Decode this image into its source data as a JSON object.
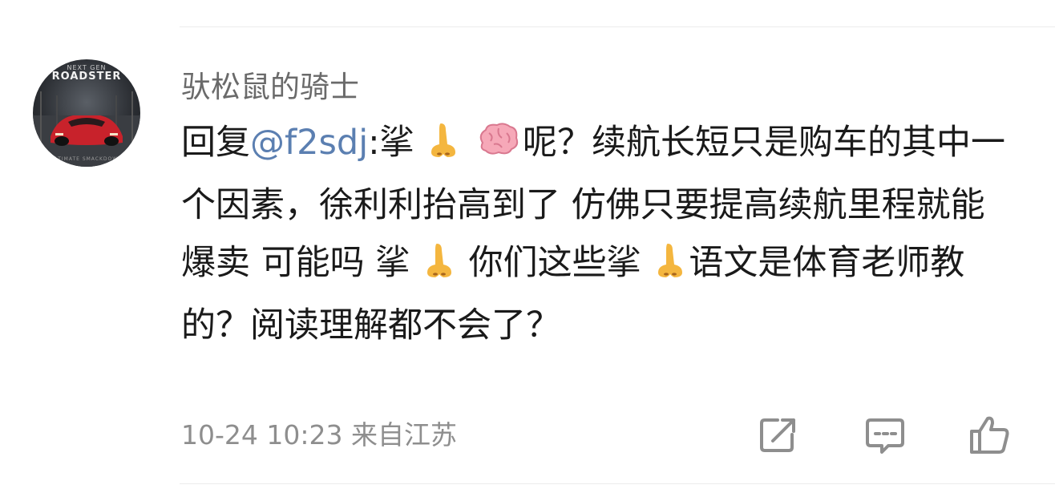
{
  "post": {
    "username": "驮松鼠的骑士",
    "avatar": {
      "brand_top": "NEXT GEN",
      "brand": "ROADSTER",
      "brand_bottom": "ULTIMATE SMACKDOWN",
      "car_color": "#c8222b"
    },
    "comment": {
      "reply_prefix": "回复",
      "mention": "@f2sdj",
      "part1": ":挲",
      "part2": "呢？续航长短只是购车的其中一个因素，徐利利抬高到了 仿佛只要提高续航里程就能爆卖 可能吗 挲",
      "part3": " 你们这些挲",
      "part4": "语文是体育老师教的？阅读理解都不会了？",
      "emoji_nose": "nose-emoji",
      "emoji_brain": "brain-emoji"
    },
    "meta": {
      "date": "10-24 10:23",
      "location": "来自江苏"
    },
    "actions": {
      "share_icon": "share-icon",
      "comment_icon": "comment-icon",
      "like_icon": "like-icon"
    },
    "colors": {
      "mention": "#5b7fb1",
      "meta": "#8e8e8e",
      "username": "#6a6a6a"
    }
  }
}
